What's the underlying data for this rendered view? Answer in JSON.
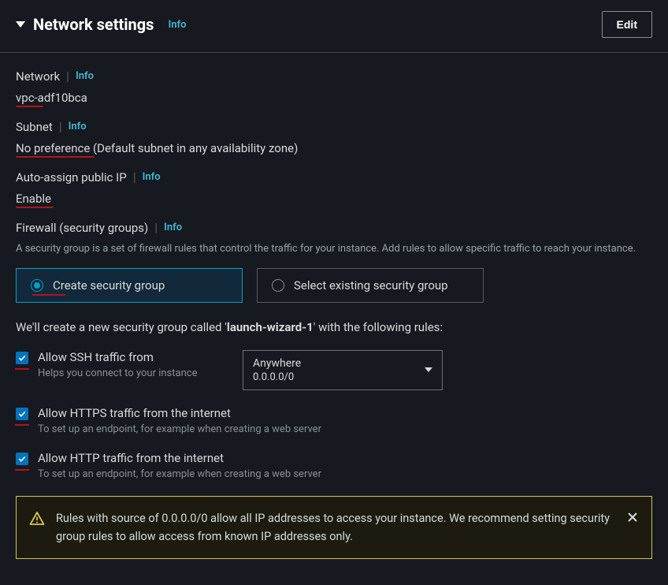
{
  "header": {
    "title": "Network settings",
    "info": "Info",
    "edit": "Edit"
  },
  "network": {
    "label": "Network",
    "info": "Info",
    "value": "vpc-adf10bca"
  },
  "subnet": {
    "label": "Subnet",
    "info": "Info",
    "value": "No preference (Default subnet in any availability zone)"
  },
  "publicIp": {
    "label": "Auto-assign public IP",
    "info": "Info",
    "value": "Enable"
  },
  "firewall": {
    "label": "Firewall (security groups)",
    "info": "Info",
    "desc": "A security group is a set of firewall rules that control the traffic for your instance. Add rules to allow specific traffic to reach your instance.",
    "createLabel": "Create security group",
    "selectLabel": "Select existing security group"
  },
  "sgText": {
    "prefix": "We'll create a new security group called '",
    "name": "launch-wizard-1",
    "suffix": "' with the following rules:"
  },
  "rules": {
    "ssh": {
      "label": "Allow SSH traffic from",
      "desc": "Helps you connect to your instance",
      "dropdownMain": "Anywhere",
      "dropdownSub": "0.0.0.0/0"
    },
    "https": {
      "label": "Allow HTTPS traffic from the internet",
      "desc": "To set up an endpoint, for example when creating a web server"
    },
    "http": {
      "label": "Allow HTTP traffic from the internet",
      "desc": "To set up an endpoint, for example when creating a web server"
    }
  },
  "warning": {
    "text": "Rules with source of 0.0.0.0/0 allow all IP addresses to access your instance. We recommend setting security group rules to allow access from known IP addresses only."
  }
}
